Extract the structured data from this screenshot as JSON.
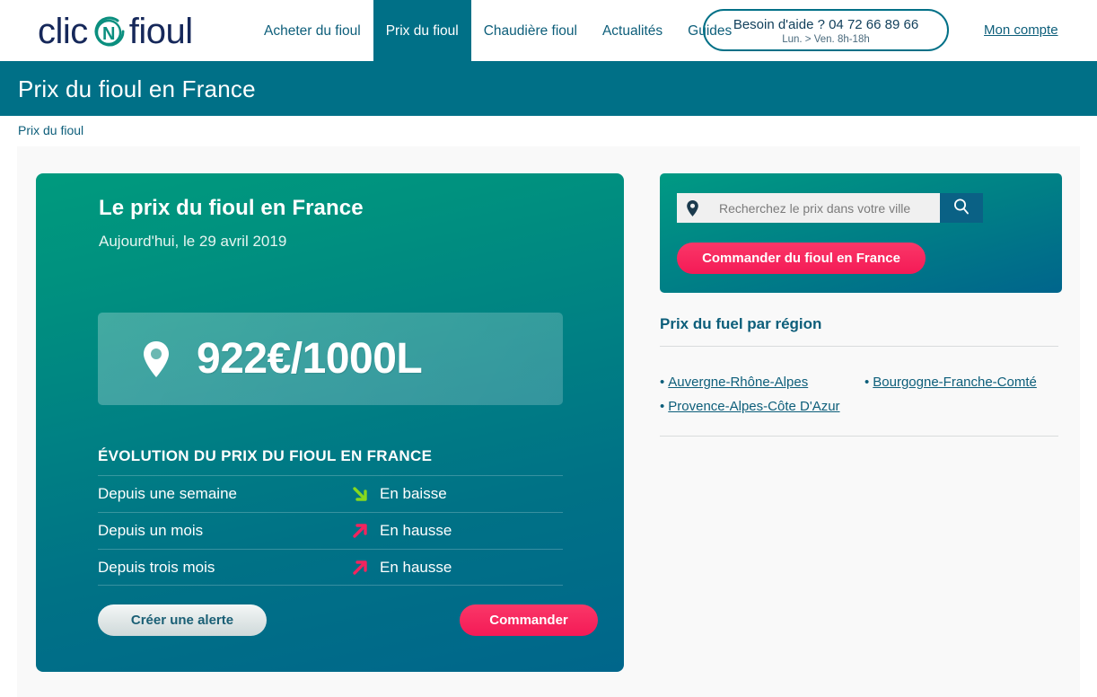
{
  "header": {
    "logo": {
      "part1": "clic",
      "middle": "N",
      "part2": "fioul",
      "icon": "clicnfioul-logo"
    },
    "nav": [
      {
        "label": "Acheter du fioul",
        "active": false
      },
      {
        "label": "Prix du fioul",
        "active": true
      },
      {
        "label": "Chaudière fioul",
        "active": false
      },
      {
        "label": "Actualités",
        "active": false
      },
      {
        "label": "Guides",
        "active": false
      }
    ],
    "help": {
      "line1": "Besoin d'aide ? 04 72 66 89 66",
      "line2": "Lun. > Ven. 8h-18h"
    },
    "account_label": "Mon compte"
  },
  "banner": {
    "title": "Prix du fioul en France"
  },
  "breadcrumb": {
    "label": "Prix du fioul"
  },
  "price_card": {
    "title": "Le prix du fioul en France",
    "date": "Aujourd'hui, le 29 avril 2019",
    "pin_icon": "location-pin-icon",
    "price": "922€/1000L",
    "evolution_title": "ÉVOLUTION DU PRIX DU FIOUL EN FRANCE",
    "evolution_rows": [
      {
        "label": "Depuis une semaine",
        "state": "En baisse",
        "direction": "down",
        "arrow_icon": "arrow-down-right-icon",
        "color": "#86d81f"
      },
      {
        "label": "Depuis un mois",
        "state": "En hausse",
        "direction": "up",
        "arrow_icon": "arrow-up-right-icon",
        "color": "#f2245e"
      },
      {
        "label": "Depuis trois mois",
        "state": "En hausse",
        "direction": "up",
        "arrow_icon": "arrow-up-right-icon",
        "color": "#f2245e"
      }
    ],
    "alert_button": "Créer une alerte",
    "order_button": "Commander"
  },
  "sidebar": {
    "search": {
      "pin_icon": "location-pin-icon",
      "placeholder": "Recherchez le prix dans votre ville",
      "value": "",
      "search_icon": "magnifier-icon"
    },
    "order_button": "Commander du fioul en France",
    "region_title": "Prix du fuel par région",
    "regions_left": [
      {
        "bullet": "•",
        "label": "Auvergne-Rhône-Alpes"
      },
      {
        "bullet": "•",
        "label": "Provence-Alpes-Côte D'Azur"
      }
    ],
    "regions_right": [
      {
        "bullet": "•",
        "label": "Bourgogne-Franche-Comté"
      }
    ]
  },
  "colors": {
    "teal": "#007087",
    "green": "#009a7e",
    "pink": "#f41a56",
    "link": "#0d5e7a"
  }
}
